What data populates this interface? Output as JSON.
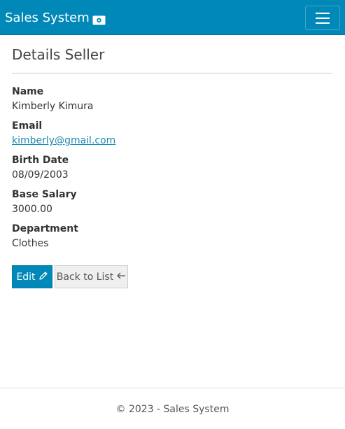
{
  "navbar": {
    "brand": "Sales System",
    "brand_icon": "money-bill-icon",
    "toggler_icon": "hamburger-menu-icon",
    "background": "#0088b8"
  },
  "page": {
    "title": "Details Seller"
  },
  "fields": [
    {
      "label": "Name",
      "value": "Kimberly Kimura"
    },
    {
      "label": "Email",
      "value": "kimberly@gmail.com"
    },
    {
      "label": "Birth Date",
      "value": "08/09/2003"
    },
    {
      "label": "Base Salary",
      "value": "3000.00"
    },
    {
      "label": "Department",
      "value": "Clothes"
    }
  ],
  "actions": {
    "edit_label": "Edit",
    "edit_icon": "pencil-icon",
    "back_label": "Back to List",
    "back_icon": "arrow-left-icon"
  },
  "footer": {
    "text": "© 2023 - Sales System"
  }
}
